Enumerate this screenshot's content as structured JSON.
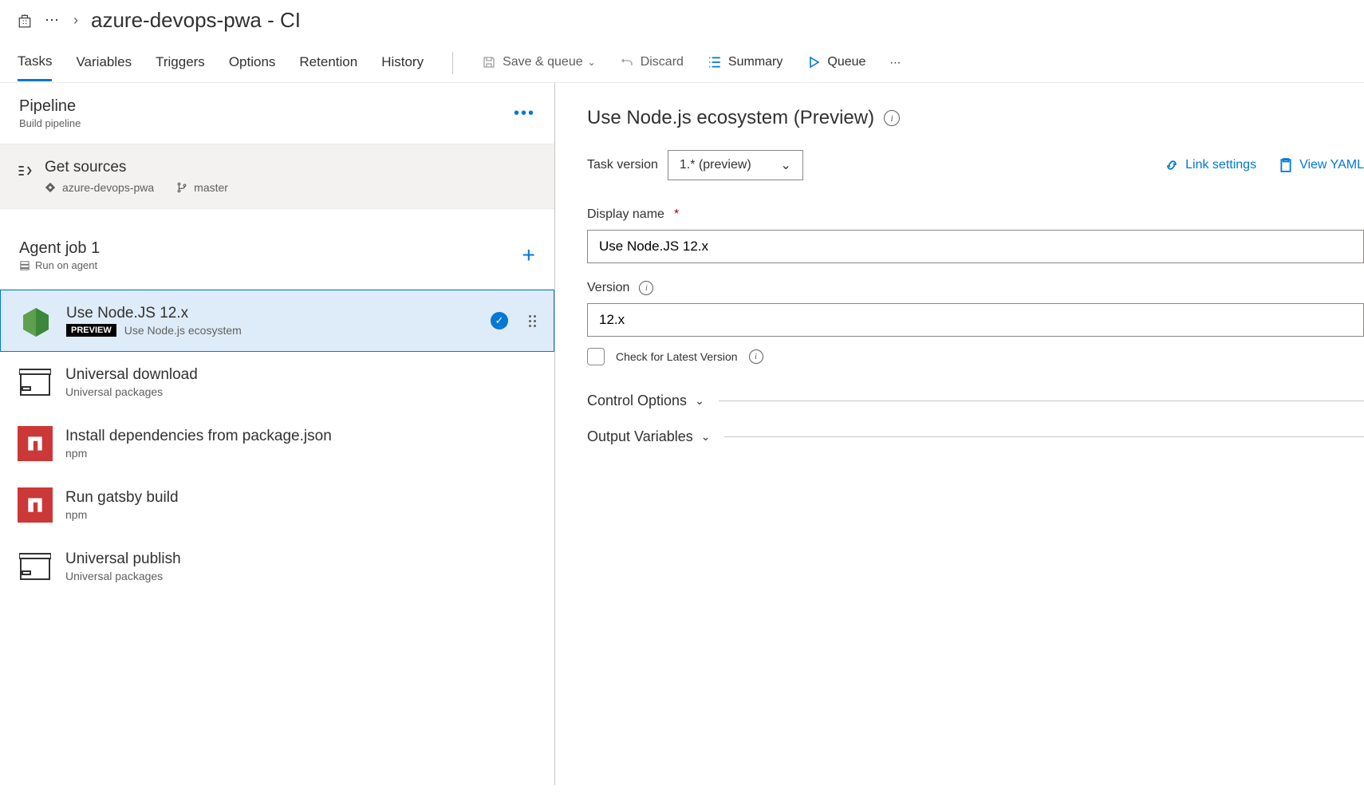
{
  "breadcrumb": {
    "title": "azure-devops-pwa - CI"
  },
  "tabs": [
    "Tasks",
    "Variables",
    "Triggers",
    "Options",
    "Retention",
    "History"
  ],
  "toolbar": {
    "save": "Save & queue",
    "discard": "Discard",
    "summary": "Summary",
    "queue": "Queue"
  },
  "pipeline": {
    "title": "Pipeline",
    "subtitle": "Build pipeline"
  },
  "getSources": {
    "title": "Get sources",
    "repo": "azure-devops-pwa",
    "branch": "master"
  },
  "agentJob": {
    "title": "Agent job 1",
    "subtitle": "Run on agent"
  },
  "tasks": [
    {
      "name": "Use Node.JS 12.x",
      "sub": "Use Node.js ecosystem",
      "badge": "PREVIEW",
      "icon": "node",
      "selected": true
    },
    {
      "name": "Universal download",
      "sub": "Universal packages",
      "icon": "box"
    },
    {
      "name": "Install dependencies from package.json",
      "sub": "npm",
      "icon": "npm"
    },
    {
      "name": "Run gatsby build",
      "sub": "npm",
      "icon": "npm"
    },
    {
      "name": "Universal publish",
      "sub": "Universal packages",
      "icon": "box"
    }
  ],
  "detail": {
    "title": "Use Node.js ecosystem (Preview)",
    "taskVersionLabel": "Task version",
    "taskVersion": "1.* (preview)",
    "linkSettings": "Link settings",
    "viewYaml": "View YAML",
    "displayNameLabel": "Display name",
    "displayName": "Use Node.JS 12.x",
    "versionLabel": "Version",
    "version": "12.x",
    "checkLatest": "Check for Latest Version",
    "controlOptions": "Control Options",
    "outputVariables": "Output Variables"
  }
}
